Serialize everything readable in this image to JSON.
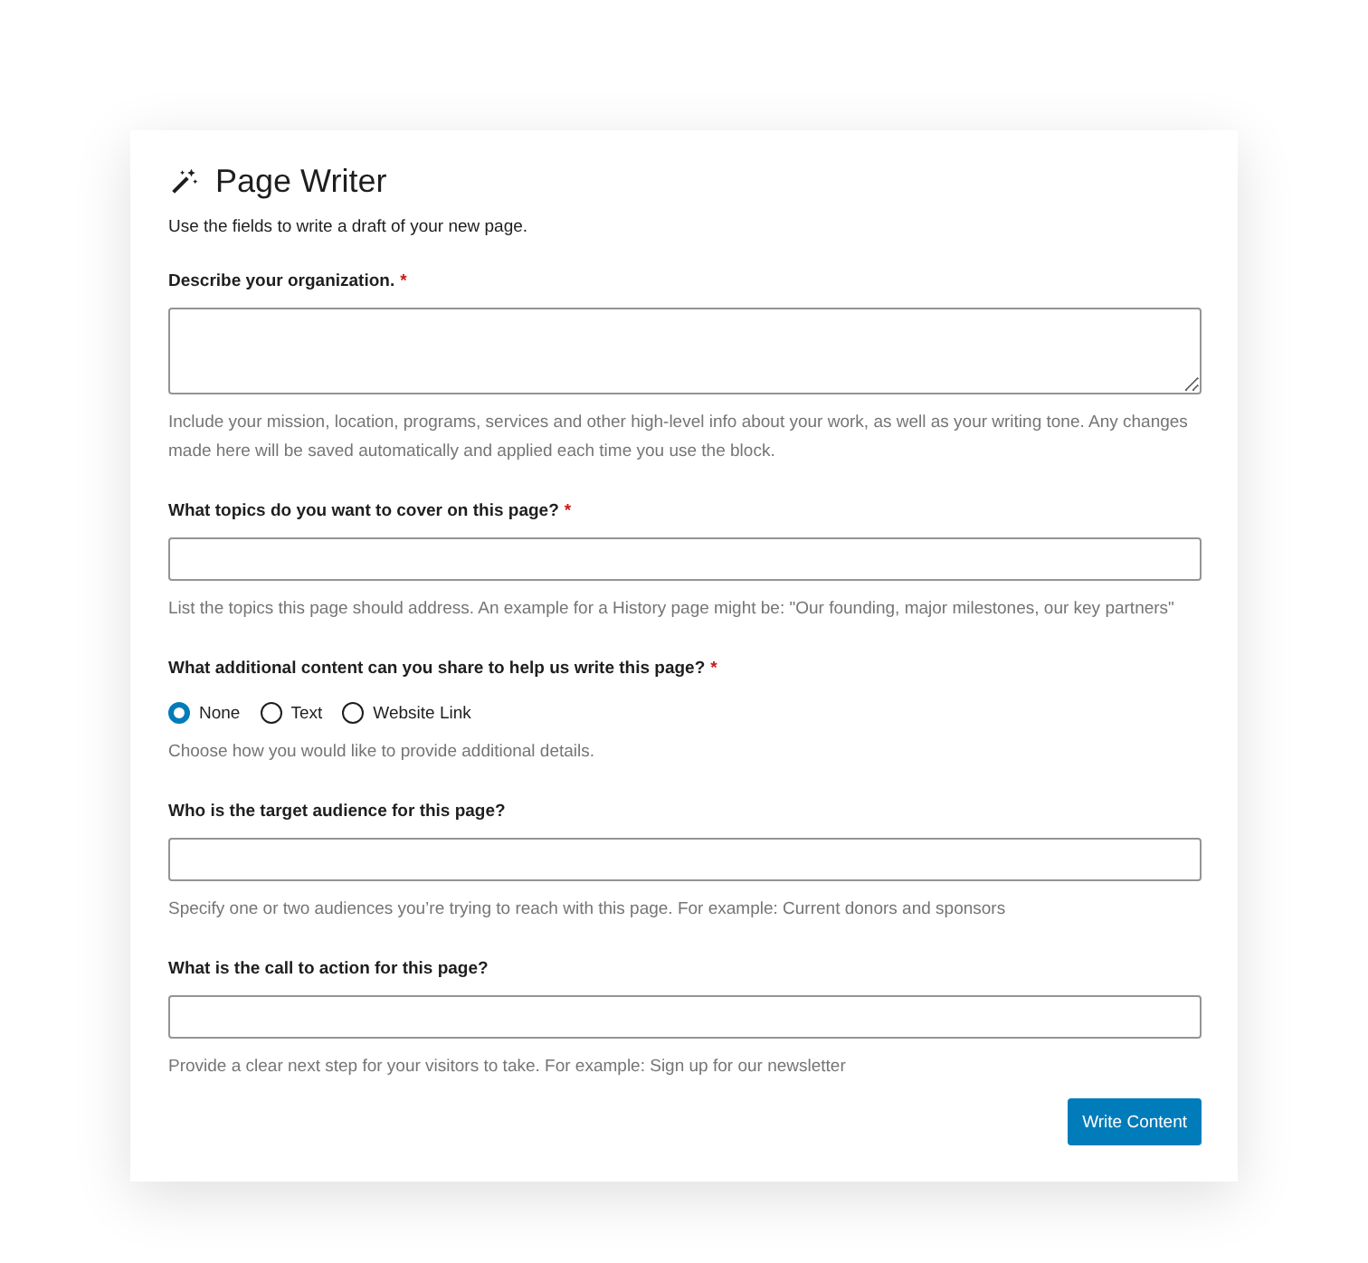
{
  "title": "Page Writer",
  "subtitle": "Use the fields to write a draft of your new page.",
  "fields": [
    {
      "kind": "textarea",
      "label": "Describe your organization.",
      "required_mark": "*",
      "help": "Include your mission, location, programs, services and other high-level info about your work, as well as your writing tone. Any changes made here will be saved automatically and applied each time you use the block."
    },
    {
      "kind": "input",
      "label": "What topics do you want to cover on this page?",
      "required_mark": "*",
      "help": "List the topics this page should address. An example for a History page might be: \"Our founding, major milestones, our key partners\""
    },
    {
      "kind": "radio",
      "label": "What additional content can you share to help us write this page?",
      "required_mark": "*",
      "options": [
        {
          "label": "None",
          "selected": true
        },
        {
          "label": "Text",
          "selected": false
        },
        {
          "label": "Website Link",
          "selected": false
        }
      ],
      "help": "Choose how you would like to provide additional details."
    },
    {
      "kind": "input",
      "label": "Who is the target audience for this page?",
      "help": "Specify one or two audiences you’re trying to reach with this page. For example: Current donors and sponsors"
    },
    {
      "kind": "input",
      "label": "What is the call to action for this page?",
      "help": "Provide a clear next step for your visitors to take. For example: Sign up for our newsletter"
    }
  ],
  "button": "Write Content"
}
